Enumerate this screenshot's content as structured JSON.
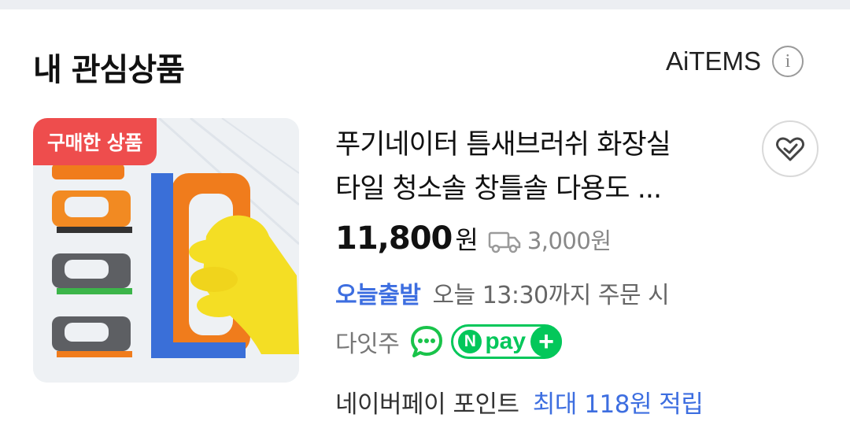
{
  "section": {
    "title": "내 관심상품"
  },
  "header": {
    "brand": "AiTEMS",
    "info_icon": "info-icon",
    "info_symbol": "i"
  },
  "product": {
    "badge": "구매한 상품",
    "title_line1": "푸기네이터 틈새브러쉬 화장실",
    "title_line2": "타일 청소솔 창틀솔 다용도 ...",
    "price": "11,800",
    "currency": "원",
    "shipping_fee": "3,000원",
    "delivery_badge": "오늘출발",
    "delivery_desc": "오늘 13:30까지 주문 시",
    "arrival_text": "다잇주",
    "npay_n": "N",
    "npay_label": "pay",
    "npay_plus": "+",
    "points_label": "네이버페이 포인트",
    "points_value": "최대 118원 적립"
  },
  "icons": {
    "wish": "heart-check-icon",
    "truck": "truck-icon",
    "talk": "talk-chat-icon"
  },
  "colors": {
    "accent_blue": "#3d6ee0",
    "badge_red": "#ee4d4d",
    "npay_green": "#03c75a",
    "talk_green": "#19c34a"
  }
}
